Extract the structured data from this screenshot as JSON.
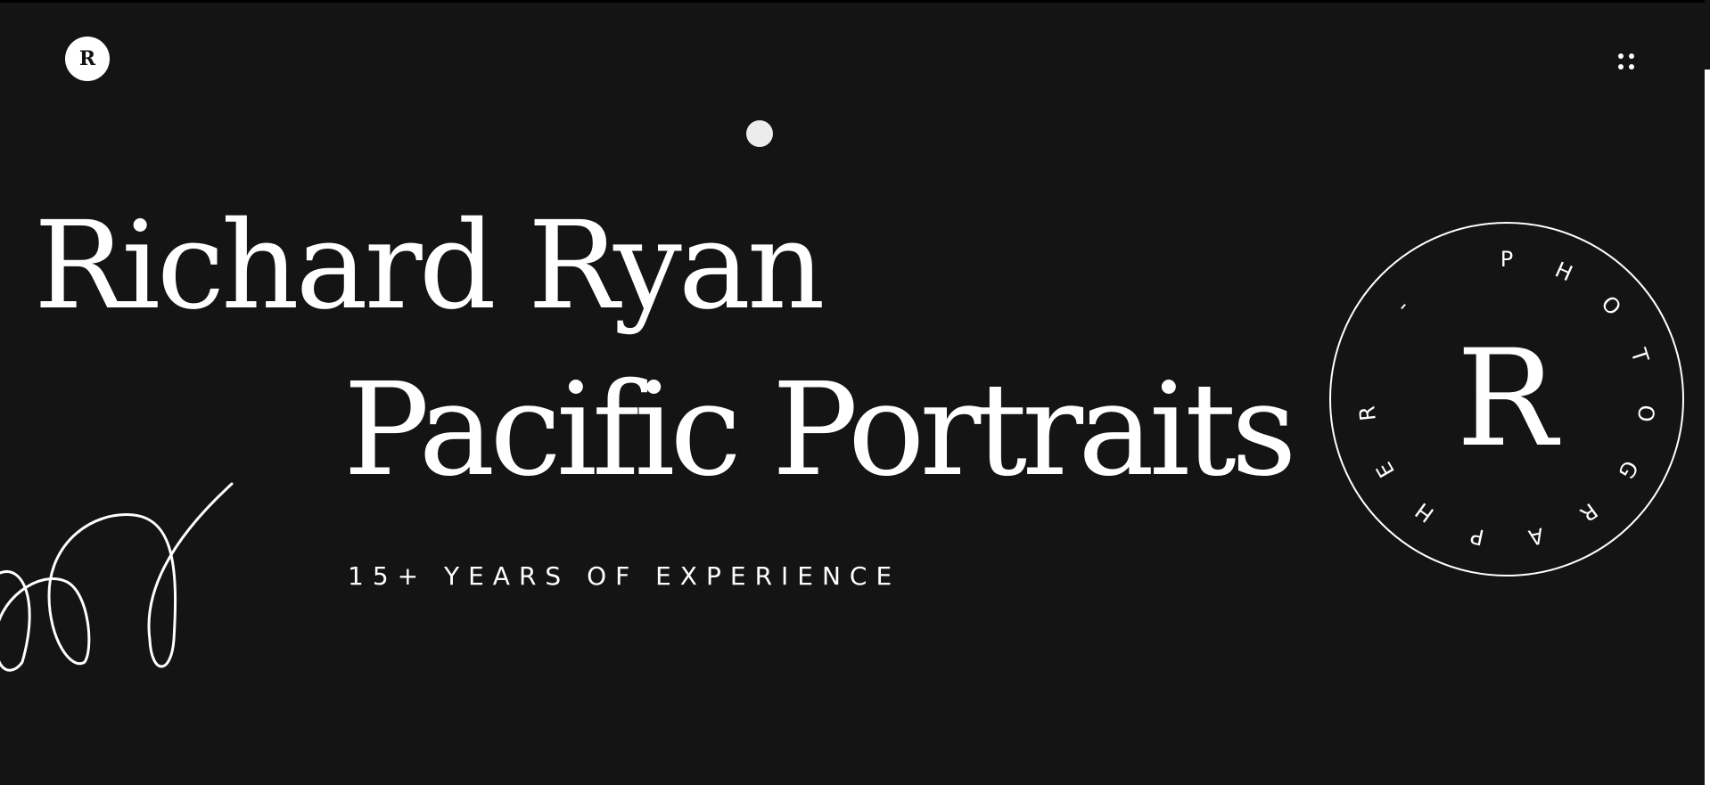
{
  "logo": {
    "letter": "R"
  },
  "menu": {
    "icon": "grid-dots-icon"
  },
  "hero": {
    "title_line_1": "Richard Ryan",
    "title_line_2": "Pacific Portraits",
    "subtitle": "15+ YEARS OF EXPERIENCE"
  },
  "stamp": {
    "letter": "R",
    "ring_text": "PHOTOGRAPHER - "
  },
  "decoration": {
    "scribble": "scribble-line-icon",
    "cursor": "cursor-dot"
  },
  "colors": {
    "background": "#141414",
    "foreground": "#ffffff",
    "cursor": "#ececec"
  }
}
